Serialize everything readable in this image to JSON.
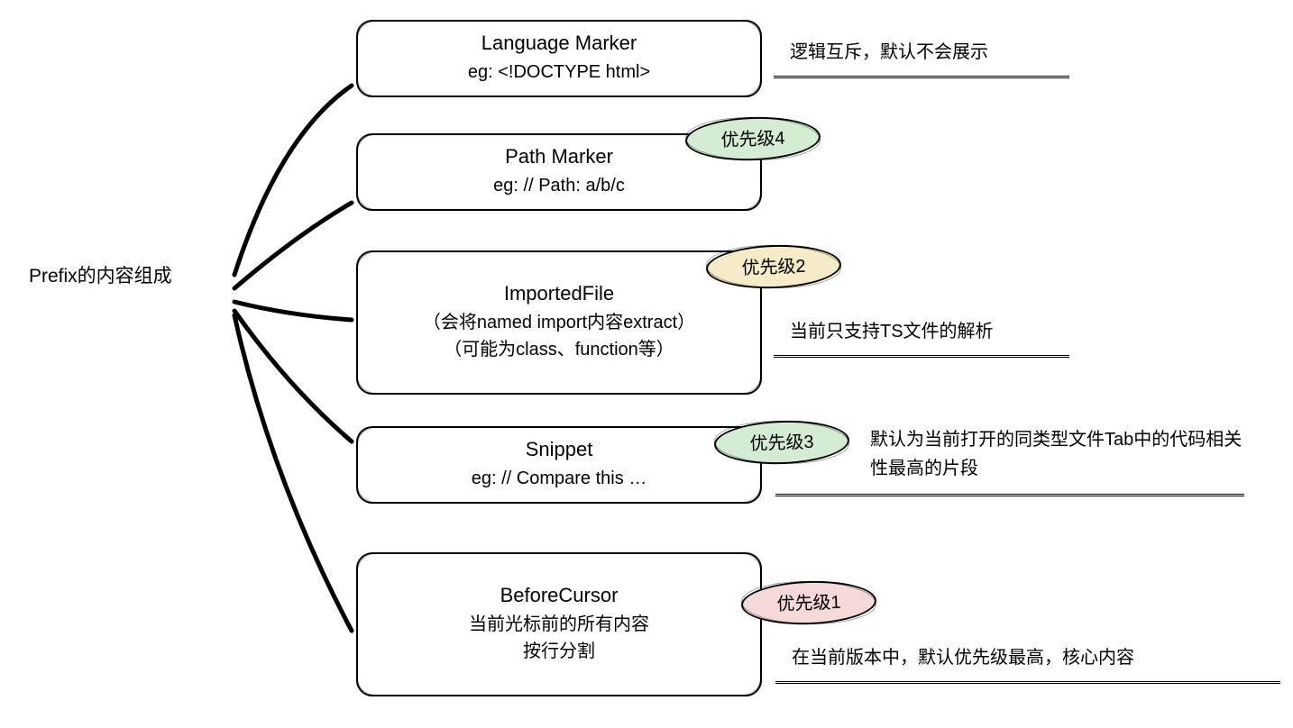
{
  "root": {
    "label": "Prefix的内容组成"
  },
  "nodes": {
    "languageMarker": {
      "title": "Language Marker",
      "example": "eg: <!DOCTYPE html>",
      "annotation": "逻辑互斥，默认不会展示"
    },
    "pathMarker": {
      "title": "Path Marker",
      "example": "eg: // Path: a/b/c",
      "priority": "优先级4"
    },
    "importedFile": {
      "title": "ImportedFile",
      "line2": "（会将named import内容extract）",
      "line3": "（可能为class、function等）",
      "priority": "优先级2",
      "annotation": "当前只支持TS文件的解析"
    },
    "snippet": {
      "title": "Snippet",
      "example": "eg: // Compare this …",
      "priority": "优先级3",
      "annotation": "默认为当前打开的同类型文件Tab中的代码相关性最高的片段"
    },
    "beforeCursor": {
      "title": "BeforeCursor",
      "line2": "当前光标前的所有内容",
      "line3": "按行分割",
      "priority": "优先级1",
      "annotation": "在当前版本中，默认优先级最高，核心内容"
    }
  }
}
